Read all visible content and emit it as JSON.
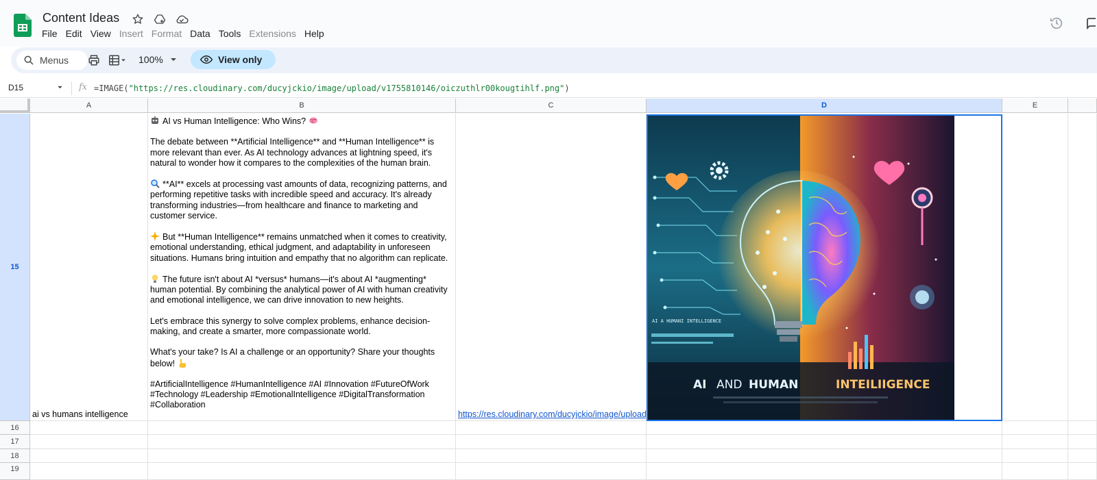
{
  "app": {
    "doc_title": "Content Ideas",
    "menus": [
      {
        "label": "File",
        "enabled": true
      },
      {
        "label": "Edit",
        "enabled": true
      },
      {
        "label": "View",
        "enabled": true
      },
      {
        "label": "Insert",
        "enabled": false
      },
      {
        "label": "Format",
        "enabled": false
      },
      {
        "label": "Data",
        "enabled": true
      },
      {
        "label": "Tools",
        "enabled": true
      },
      {
        "label": "Extensions",
        "enabled": false
      },
      {
        "label": "Help",
        "enabled": true
      }
    ]
  },
  "toolbar": {
    "search_label": "Menus",
    "zoom": "100%",
    "view_only_label": "View only"
  },
  "formula_bar": {
    "cell_ref": "D15",
    "fx": "fx",
    "formula_prefix": "=IMAGE(",
    "formula_string": "\"https://res.cloudinary.com/ducyjckio/image/upload/v1755810146/oiczuthlr00kougtihlf.png\"",
    "formula_suffix": ")"
  },
  "columns": [
    "A",
    "B",
    "C",
    "D",
    "E"
  ],
  "selected_column": "D",
  "rows": [
    "15",
    "16",
    "17",
    "18",
    "19"
  ],
  "selected_row": "15",
  "row15": {
    "a": "ai vs humans intelligence",
    "b_title": "AI vs Human Intelligence: Who Wins?",
    "b_paragraphs": [
      "The debate between **Artificial Intelligence** and **Human Intelligence** is more relevant than ever. As AI technology advances at lightning speed, it's natural to wonder how it compares to the complexities of the human brain.",
      "**AI** excels at processing vast amounts of data, recognizing patterns, and performing repetitive tasks with incredible speed and accuracy. It's already transforming industries—from healthcare and finance to marketing and customer service.",
      "But **Human Intelligence** remains unmatched when it comes to creativity, emotional understanding, ethical judgment, and adaptability in unforeseen situations. Humans bring intuition and empathy that no algorithm can replicate.",
      "The future isn't about AI *versus* humans—it's about AI *augmenting* human potential. By combining the analytical power of AI with human creativity and emotional intelligence, we can drive innovation to new heights.",
      "Let's embrace this synergy to solve complex problems, enhance decision-making, and create a smarter, more compassionate world.",
      "What's your take? Is AI a challenge or an opportunity? Share your thoughts below!",
      "#ArtificialIntelligence #HumanIntelligence #AI #Innovation #FutureOfWork #Technology #Leadership #EmotionalIntelligence #DigitalTransformation #Collaboration"
    ],
    "c_link": "https://res.cloudinary.com/ducyjckio/image/upload/v1755810146/oiczuthlr00kougtihlf.png",
    "d_image": {
      "small_label": "AI A HUMANI INTELLIGENCE",
      "title_left": "AI",
      "title_and": "AND",
      "title_human": "HUMAN",
      "title_right": "INTEILIIGENCE",
      "ai_side_color": "#1b6d86",
      "human_side_color": "#f49a2a"
    }
  },
  "icons": {
    "star": "star-icon",
    "drive": "move-to-drive-icon",
    "cloud": "cloud-status-icon",
    "history": "history-icon",
    "search": "search-icon",
    "print": "print-icon",
    "format": "paint-format-icon",
    "eye": "eye-icon"
  }
}
